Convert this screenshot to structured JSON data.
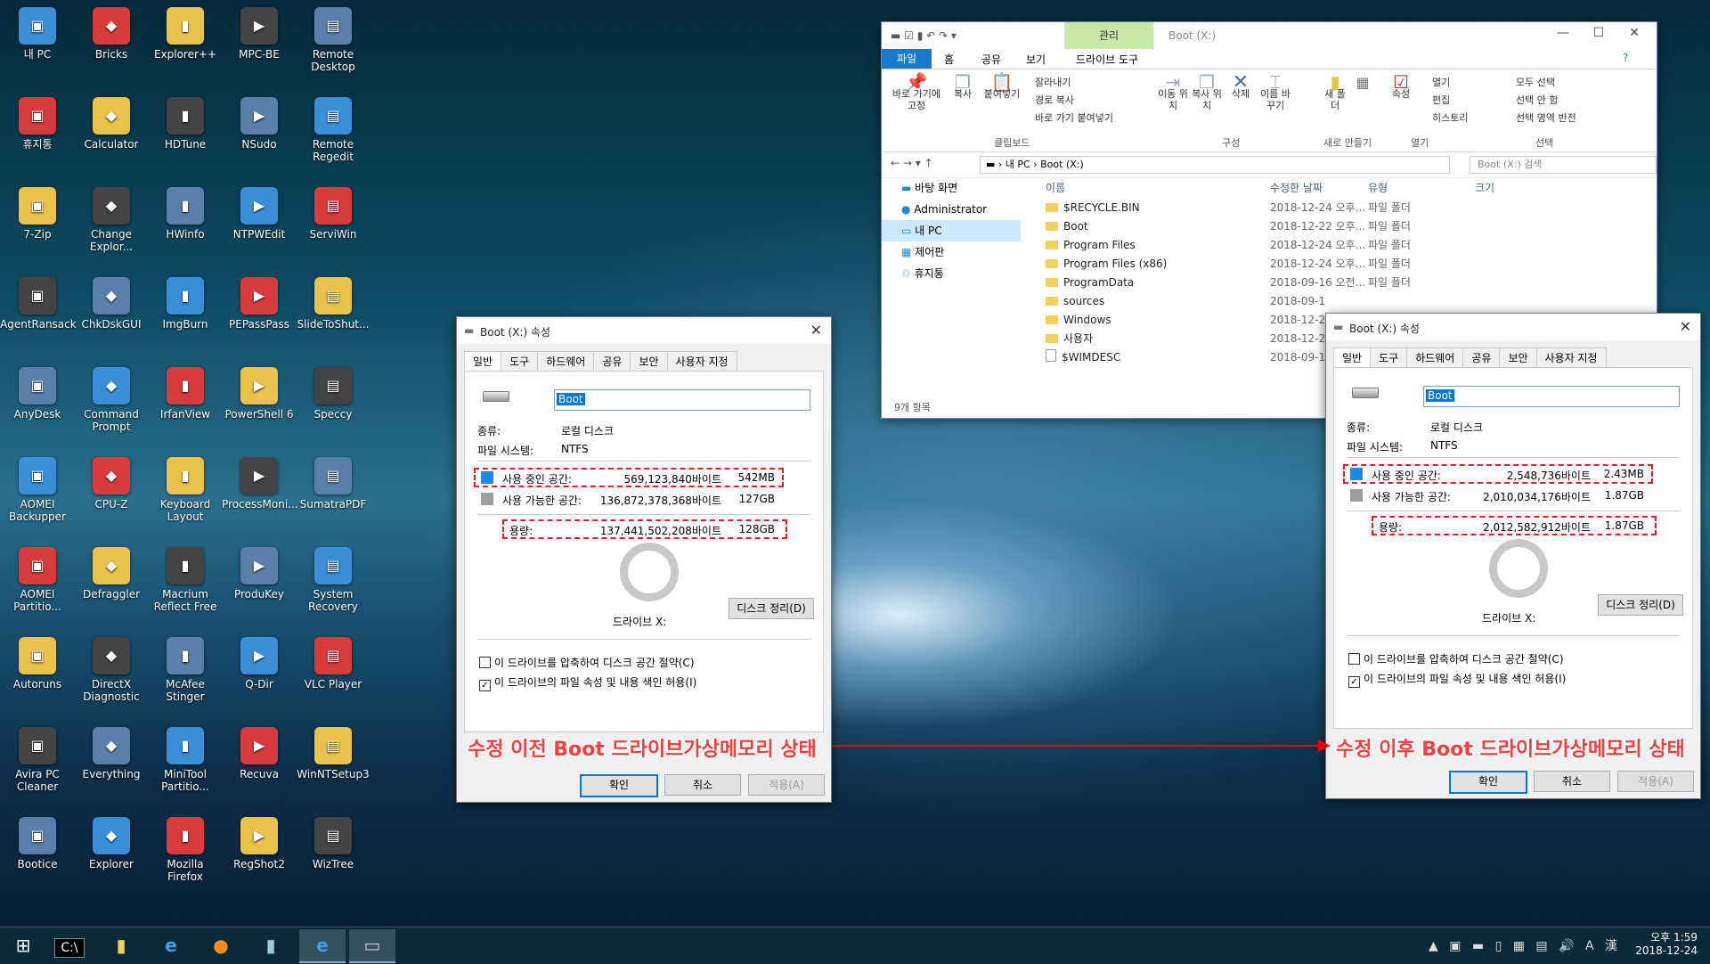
{
  "desktop": {
    "icons": [
      [
        "내 PC",
        "Bricks",
        "Explorer++",
        "MPC-BE",
        "Remote Desktop"
      ],
      [
        "휴지통",
        "Calculator",
        "HDTune",
        "NSudo",
        "Remote Regedit"
      ],
      [
        "7-Zip",
        "Change Explor...",
        "HWinfo",
        "NTPWEdit",
        "ServiWin"
      ],
      [
        "AgentRansack",
        "ChkDskGUI",
        "ImgBurn",
        "PEPassPass",
        "SlideToShut..."
      ],
      [
        "AnyDesk",
        "Command Prompt",
        "IrfanView",
        "PowerShell 6",
        "Speccy"
      ],
      [
        "AOMEI Backupper",
        "CPU-Z",
        "Keyboard Layout",
        "ProcessMoni...",
        "SumatraPDF"
      ],
      [
        "AOMEI Partitio...",
        "Defraggler",
        "Macrium Reflect Free",
        "ProduKey",
        "System Recovery"
      ],
      [
        "Autoruns",
        "DirectX Diagnostic",
        "McAfee Stinger",
        "Q-Dir",
        "VLC Player"
      ],
      [
        "Avira PC Cleaner",
        "Everything",
        "MiniTool Partitio...",
        "Recuva",
        "WinNTSetup3"
      ],
      [
        "Bootice",
        "Explorer",
        "Mozilla Firefox",
        "RegShot2",
        "WizTree"
      ]
    ],
    "icon_colors": [
      "#3b8ed8",
      "#d83b3b",
      "#e8c24a",
      "#444444",
      "#5a7fa8"
    ]
  },
  "explorer": {
    "title": "Boot (X:)",
    "manage_tab": "관리",
    "drive_tools_tab": "드라이브 도구",
    "tabs": [
      "파일",
      "홈",
      "공유",
      "보기"
    ],
    "ribbon": {
      "pin": "바로 가기에 고정",
      "copy": "복사",
      "paste": "붙여넣기",
      "cut": "잘라내기",
      "copy_path": "경로 복사",
      "paste_shortcut": "바로 가기 붙여넣기",
      "clipboard": "클립보드",
      "move_to": "이동 위치",
      "copy_to": "복사 위치",
      "delete": "삭제",
      "rename": "이름 바꾸기",
      "organize": "구성",
      "new_folder": "새 폴더",
      "new": "새로 만들기",
      "properties": "속성",
      "open_btn": "열기",
      "edit": "편집",
      "history": "히스토리",
      "open": "열기",
      "select_all": "모두 선택",
      "select_none": "선택 안 함",
      "invert": "선택 영역 반전",
      "select": "선택"
    },
    "address": [
      "내 PC",
      "Boot (X:)"
    ],
    "search_placeholder": "Boot (X:) 검색",
    "nav": [
      "바탕 화면",
      "Administrator",
      "내 PC",
      "제어판",
      "휴지통"
    ],
    "columns": [
      "이름",
      "수정한 날짜",
      "유형",
      "크기"
    ],
    "rows": [
      [
        "$RECYCLE.BIN",
        "2018-12-24 오후...",
        "파일 폴더"
      ],
      [
        "Boot",
        "2018-12-22 오후...",
        "파일 폴더"
      ],
      [
        "Program Files",
        "2018-12-24 오후...",
        "파일 폴더"
      ],
      [
        "Program Files (x86)",
        "2018-12-24 오후...",
        "파일 폴더"
      ],
      [
        "ProgramData",
        "2018-09-16 오전...",
        "파일 폴더"
      ],
      [
        "sources",
        "2018-09-1",
        ""
      ],
      [
        "Windows",
        "2018-12-2",
        ""
      ],
      [
        "사용자",
        "2018-12-2",
        ""
      ],
      [
        "$WIMDESC",
        "2018-09-1",
        ""
      ]
    ],
    "status": "9개 항목"
  },
  "dialogs": {
    "before": {
      "title": "Boot (X:) 속성",
      "tabs": [
        "일반",
        "도구",
        "하드웨어",
        "공유",
        "보안",
        "사용자 지정"
      ],
      "name": "Boot",
      "type_label": "종류:",
      "type_value": "로컬 디스크",
      "fs_label": "파일 시스템:",
      "fs_value": "NTFS",
      "used_label": "사용 중인 공간:",
      "used_bytes": "569,123,840바이트",
      "used_size": "542MB",
      "free_label": "사용 가능한 공간:",
      "free_bytes": "136,872,378,368바이트",
      "free_size": "127GB",
      "cap_label": "용량:",
      "cap_bytes": "137,441,502,208바이트",
      "cap_size": "128GB",
      "drive": "드라이브 X:",
      "cleanup": "디스크 정리(D)",
      "compress": "이 드라이브를 압축하여 디스크 공간 절약(C)",
      "index": "이 드라이브의 파일 속성 및 내용 색인 허용(I)",
      "ok": "확인",
      "cancel": "취소",
      "apply": "적용(A)"
    },
    "after": {
      "title": "Boot (X:) 속성",
      "tabs": [
        "일반",
        "도구",
        "하드웨어",
        "공유",
        "보안",
        "사용자 지정"
      ],
      "name": "Boot",
      "type_label": "종류:",
      "type_value": "로컬 디스크",
      "fs_label": "파일 시스템:",
      "fs_value": "NTFS",
      "used_label": "사용 중인 공간:",
      "used_bytes": "2,548,736바이트",
      "used_size": "2.43MB",
      "free_label": "사용 가능한 공간:",
      "free_bytes": "2,010,034,176바이트",
      "free_size": "1.87GB",
      "cap_label": "용량:",
      "cap_bytes": "2,012,582,912바이트",
      "cap_size": "1.87GB",
      "drive": "드라이브 X:",
      "cleanup": "디스크 정리(D)",
      "compress": "이 드라이브를 압축하여 디스크 공간 절약(C)",
      "index": "이 드라이브의 파일 속성 및 내용 색인 허용(I)",
      "ok": "확인",
      "cancel": "취소",
      "apply": "적용(A)"
    }
  },
  "annotations": {
    "before": "수정 이전 Boot 드라이브가상메모리 상태",
    "after": "수정 이후 Boot 드라이브가상메모리 상태"
  },
  "taskbar": {
    "clock_time": "오후 1:59",
    "clock_date": "2018-12-24",
    "ime": "A",
    "ime2": "漢"
  },
  "colors": {
    "used": "#1e88e5",
    "free": "#9e9e9e",
    "highlight": "#e02020",
    "accent": "#0078d7"
  }
}
